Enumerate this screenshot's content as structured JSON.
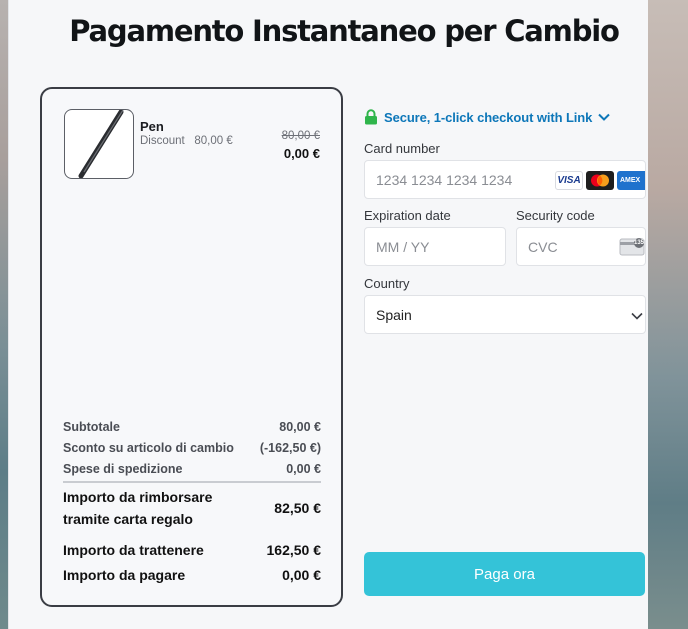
{
  "title": "Pagamento Instantaneo per Cambio",
  "item": {
    "name": "Pen",
    "discount_label": "Discount",
    "discount_value": "80,00 €",
    "original_price": "80,00 €",
    "price": "0,00 €"
  },
  "summary": {
    "lines": [
      {
        "label": "Subtotale",
        "value": "80,00 €"
      },
      {
        "label": "Sconto su articolo di cambio",
        "value": "(-162,50 €)"
      },
      {
        "label": "Spese di spedizione",
        "value": "0,00 €"
      }
    ],
    "refund": {
      "label_line1": "Importo da rimborsare",
      "label_line2": "tramite carta regalo",
      "value": "82,50 €"
    },
    "withhold": {
      "label": "Importo da trattenere",
      "value": "162,50 €"
    },
    "to_pay": {
      "label": "Importo da pagare",
      "value": "0,00 €"
    }
  },
  "payment": {
    "link_text": "Secure, 1-click checkout with Link",
    "card_number_label": "Card number",
    "card_number_placeholder": "1234 1234 1234 1234",
    "card_brands": {
      "visa": "VISA",
      "amex": "AMEX"
    },
    "expiration_label": "Expiration date",
    "expiration_placeholder": "MM / YY",
    "security_label": "Security code",
    "security_placeholder": "CVC",
    "cvc_hint": "135",
    "country_label": "Country",
    "country_value": "Spain",
    "pay_button": "Paga ora"
  },
  "colors": {
    "accent": "#34c3d8",
    "link": "#0d77b9",
    "lock": "#2fb54b"
  },
  "icons": [
    "lock-icon",
    "chevron-down-icon",
    "visa-icon",
    "mastercard-icon",
    "amex-icon",
    "cvc-card-icon",
    "select-chevron-icon"
  ]
}
